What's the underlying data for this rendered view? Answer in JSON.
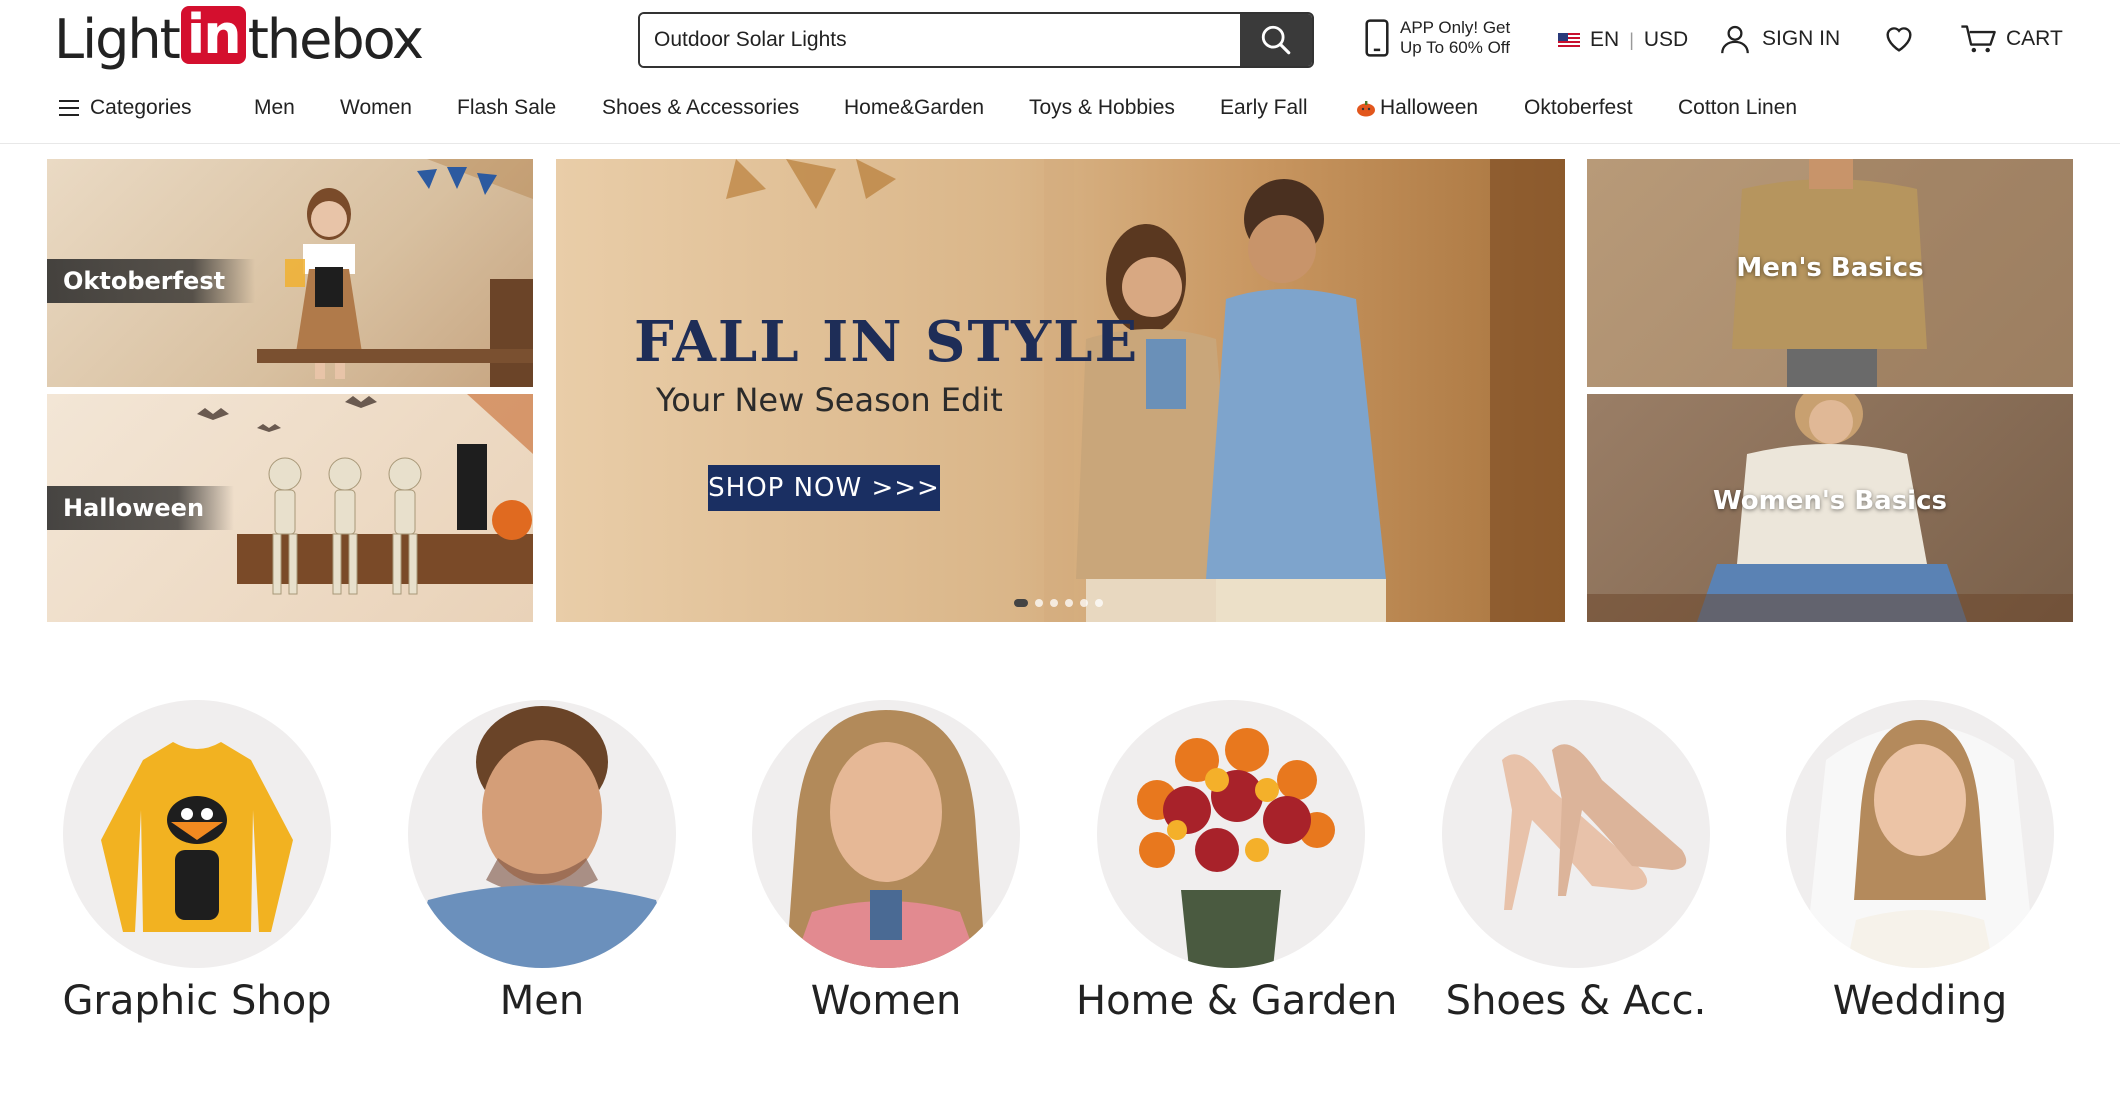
{
  "header": {
    "logo_pre": "Light",
    "logo_box": "in",
    "logo_post": "thebox",
    "search_value": "Outdoor Solar Lights",
    "app_line1": "APP Only! Get",
    "app_line2": "Up To 60% Off",
    "lang": "EN",
    "currency": "USD",
    "sign_in": "SIGN IN",
    "cart": "CART"
  },
  "nav": {
    "categories": "Categories",
    "items": [
      "Men",
      "Women",
      "Flash Sale",
      "Shoes & Accessories",
      "Home&Garden",
      "Toys & Hobbies",
      "Early Fall",
      "Halloween",
      "Oktoberfest",
      "Cotton Linen"
    ]
  },
  "banners": {
    "left_top": "Oktoberfest",
    "left_bottom": "Halloween",
    "hero_title": "FALL IN STYLE",
    "hero_sub": "Your New Season Edit",
    "hero_btn": "SHOP NOW >>>",
    "right_top": "Men's Basics",
    "right_bottom": "Women's Basics"
  },
  "categories": [
    "Graphic Shop",
    "Men",
    "Women",
    "Home & Garden",
    "Shoes & Acc.",
    "Wedding"
  ]
}
